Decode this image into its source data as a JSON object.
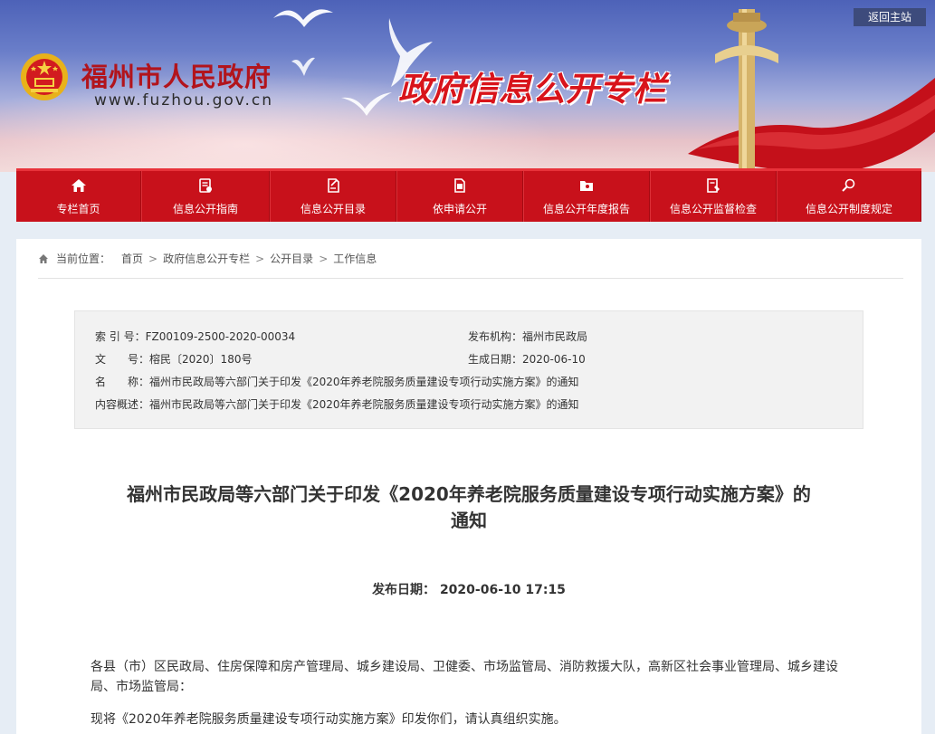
{
  "header": {
    "site_name": "福州市人民政府",
    "site_url": "www.fuzhou.gov.cn",
    "banner_title": "政府信息公开专栏",
    "home_link": "返回主站"
  },
  "nav": [
    {
      "label": "专栏首页",
      "icon": "home-icon"
    },
    {
      "label": "信息公开指南",
      "icon": "guide-icon"
    },
    {
      "label": "信息公开目录",
      "icon": "catalog-icon"
    },
    {
      "label": "依申请公开",
      "icon": "application-icon"
    },
    {
      "label": "信息公开年度报告",
      "icon": "report-icon"
    },
    {
      "label": "信息公开监督检查",
      "icon": "supervision-icon"
    },
    {
      "label": "信息公开制度规定",
      "icon": "regulation-icon"
    }
  ],
  "breadcrumb": {
    "label": "当前位置：",
    "items": [
      "首页",
      "政府信息公开专栏",
      "公开目录",
      "工作信息"
    ],
    "separator": ">"
  },
  "meta": {
    "index_label": "索 引 号：",
    "index_value": "FZ00109-2500-2020-00034",
    "publisher_label": "发布机构：",
    "publisher_value": "福州市民政局",
    "docno_label": "文　　号：",
    "docno_value": "榕民〔2020〕180号",
    "gendate_label": "生成日期：",
    "gendate_value": "2020-06-10",
    "name_label": "名　　称：",
    "name_value": "福州市民政局等六部门关于印发《2020年养老院服务质量建设专项行动实施方案》的通知",
    "summary_label": "内容概述：",
    "summary_value": "福州市民政局等六部门关于印发《2020年养老院服务质量建设专项行动实施方案》的通知"
  },
  "article": {
    "title_line1": "福州市民政局等六部门关于印发《2020年养老院服务质量建设专项行动实施方案》的",
    "title_line2": "通知",
    "date_label": "发布日期：",
    "date_value": "2020-06-10 17:15",
    "para1": "各县（市）区民政局、住房保障和房产管理局、城乡建设局、卫健委、市场监管局、消防救援大队，高新区社会事业管理局、城乡建设局、市场监管局：",
    "para2": "现将《2020年养老院服务质量建设专项行动实施方案》印发你们，请认真组织实施。"
  },
  "colors": {
    "nav_red": "#c8111b",
    "title_red": "#d8141b",
    "page_bg": "#e6edf5"
  }
}
